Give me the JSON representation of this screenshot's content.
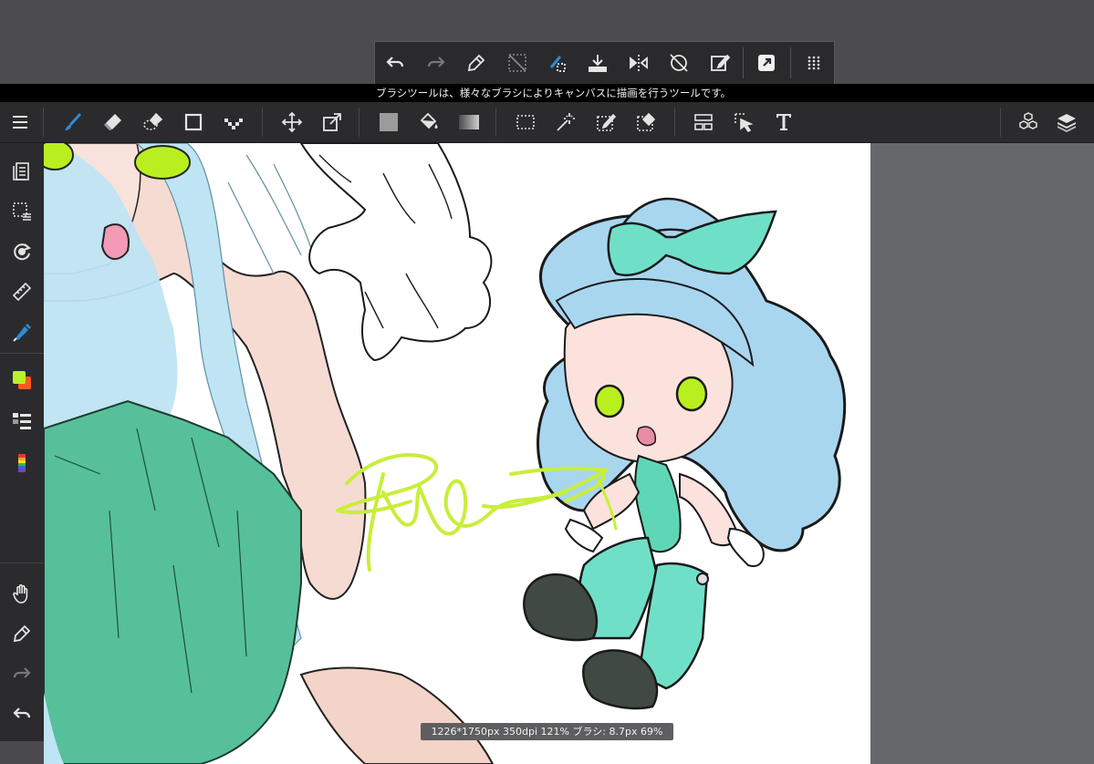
{
  "hint": {
    "text": "ブラシツールは、様々なブラシによりキャンバスに描画を行うツールです。"
  },
  "status": {
    "text": "1226*1750px 350dpi 121% ブラシ: 8.7px 69%"
  },
  "colors": {
    "accent": "#2e8bd6",
    "main_color": "#b6f12a",
    "sub_color": "#ff5a1f",
    "stroke": "#c8ee3a"
  },
  "quickbar": [
    {
      "icon": "undo-icon"
    },
    {
      "icon": "redo-icon"
    },
    {
      "icon": "eyedropper-icon"
    },
    {
      "icon": "clear-selection-icon"
    },
    {
      "icon": "fill-selection-icon"
    },
    {
      "icon": "save-icon"
    },
    {
      "icon": "flip-horizontal-icon"
    },
    {
      "icon": "snap-off-icon"
    },
    {
      "icon": "edit-icon"
    },
    {
      "icon": "external-link-icon"
    },
    {
      "icon": "grid-menu-icon"
    }
  ],
  "toolbar": [
    {
      "icon": "menu-icon"
    },
    {
      "icon": "brush-icon"
    },
    {
      "icon": "eraser-icon"
    },
    {
      "icon": "blur-eraser-icon"
    },
    {
      "icon": "shape-icon"
    },
    {
      "icon": "dot-brush-icon"
    },
    {
      "icon": "move-icon"
    },
    {
      "icon": "transform-icon"
    },
    {
      "icon": "fill-color-icon"
    },
    {
      "icon": "bucket-icon"
    },
    {
      "icon": "gradient-icon"
    },
    {
      "icon": "select-rect-icon"
    },
    {
      "icon": "magic-wand-icon"
    },
    {
      "icon": "select-pen-icon"
    },
    {
      "icon": "select-eraser-icon"
    },
    {
      "icon": "panel-layout-icon"
    },
    {
      "icon": "select-layer-icon"
    },
    {
      "icon": "text-icon"
    },
    {
      "icon": "material-icon"
    },
    {
      "icon": "layers-icon"
    }
  ],
  "sidebar": [
    {
      "icon": "pages-icon"
    },
    {
      "icon": "selection-list-icon"
    },
    {
      "icon": "rotate-icon"
    },
    {
      "icon": "ruler-icon"
    },
    {
      "icon": "snap-pen-icon"
    },
    {
      "icon": "color-swatch-icon"
    },
    {
      "icon": "layer-list-icon"
    },
    {
      "icon": "color-palette-icon"
    },
    {
      "icon": "hand-icon"
    },
    {
      "icon": "dropper-icon"
    },
    {
      "icon": "redo-icon"
    },
    {
      "icon": "undo-icon"
    }
  ]
}
